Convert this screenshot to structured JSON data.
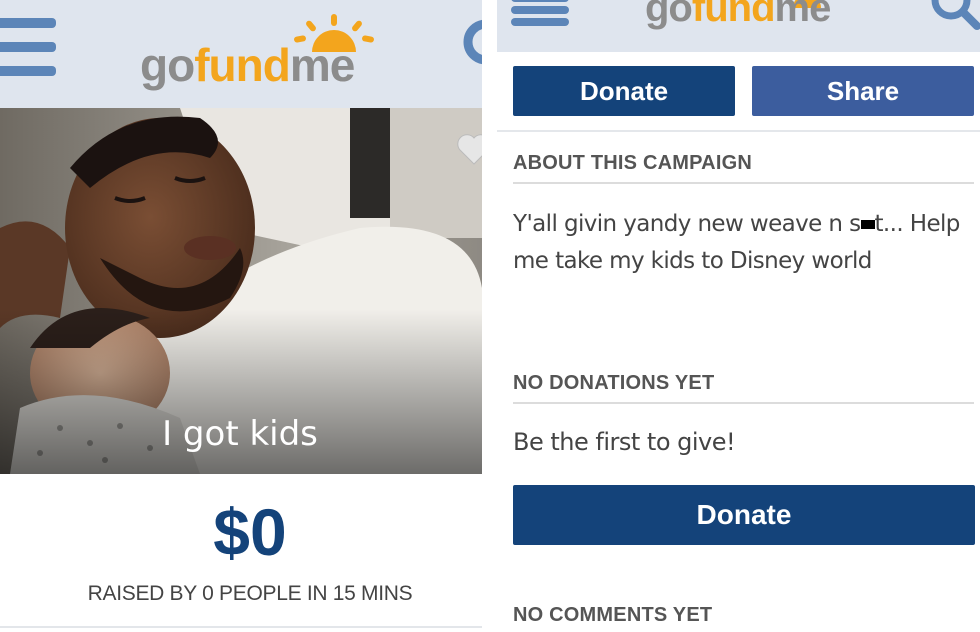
{
  "brand": {
    "logo_go": "go",
    "logo_fund": "fund",
    "logo_me": "me"
  },
  "campaign": {
    "photo_caption": "I got kids",
    "amount_raised": "$0",
    "raised_summary": "RAISED BY 0 PEOPLE IN 15 MINS"
  },
  "actions": {
    "donate_label": "Donate",
    "share_label": "Share",
    "donate_bottom_label": "Donate"
  },
  "about": {
    "title": "ABOUT THIS CAMPAIGN",
    "text_part1": "Y'all givin yandy new weave n s",
    "text_part2": "t... Help me take my kids to Disney world"
  },
  "donations": {
    "title": "NO DONATIONS YET",
    "prompt": "Be the first to give!"
  },
  "comments": {
    "title": "NO COMMENTS YET"
  },
  "colors": {
    "primary": "#14437a",
    "share": "#3c5d9e",
    "header_bg": "#dfe5ee",
    "logo_orange": "#f3a51d",
    "logo_gray": "#8c8c8c"
  }
}
